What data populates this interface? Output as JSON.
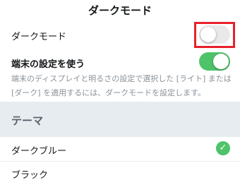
{
  "header": {
    "title": "ダークモード"
  },
  "dark_mode": {
    "label": "ダークモード",
    "toggle_on": false
  },
  "use_device_settings": {
    "label": "端末の設定を使う",
    "toggle_on": true,
    "description": "端末のディスプレイと明るさの設定で選択した [ライト] または [ダーク] を適用するには、ダークモードを設定します。"
  },
  "theme": {
    "section_title": "テーマ",
    "options": [
      {
        "label": "ダークブルー",
        "selected": true
      },
      {
        "label": "ブラック",
        "selected": false
      }
    ]
  },
  "colors": {
    "toggle_on": "#4ec36a",
    "toggle_off": "#e9e9ea",
    "highlight": "#e8202a",
    "section_band": "#e6ecf0"
  },
  "icons": {
    "selected_check": "check-icon"
  }
}
